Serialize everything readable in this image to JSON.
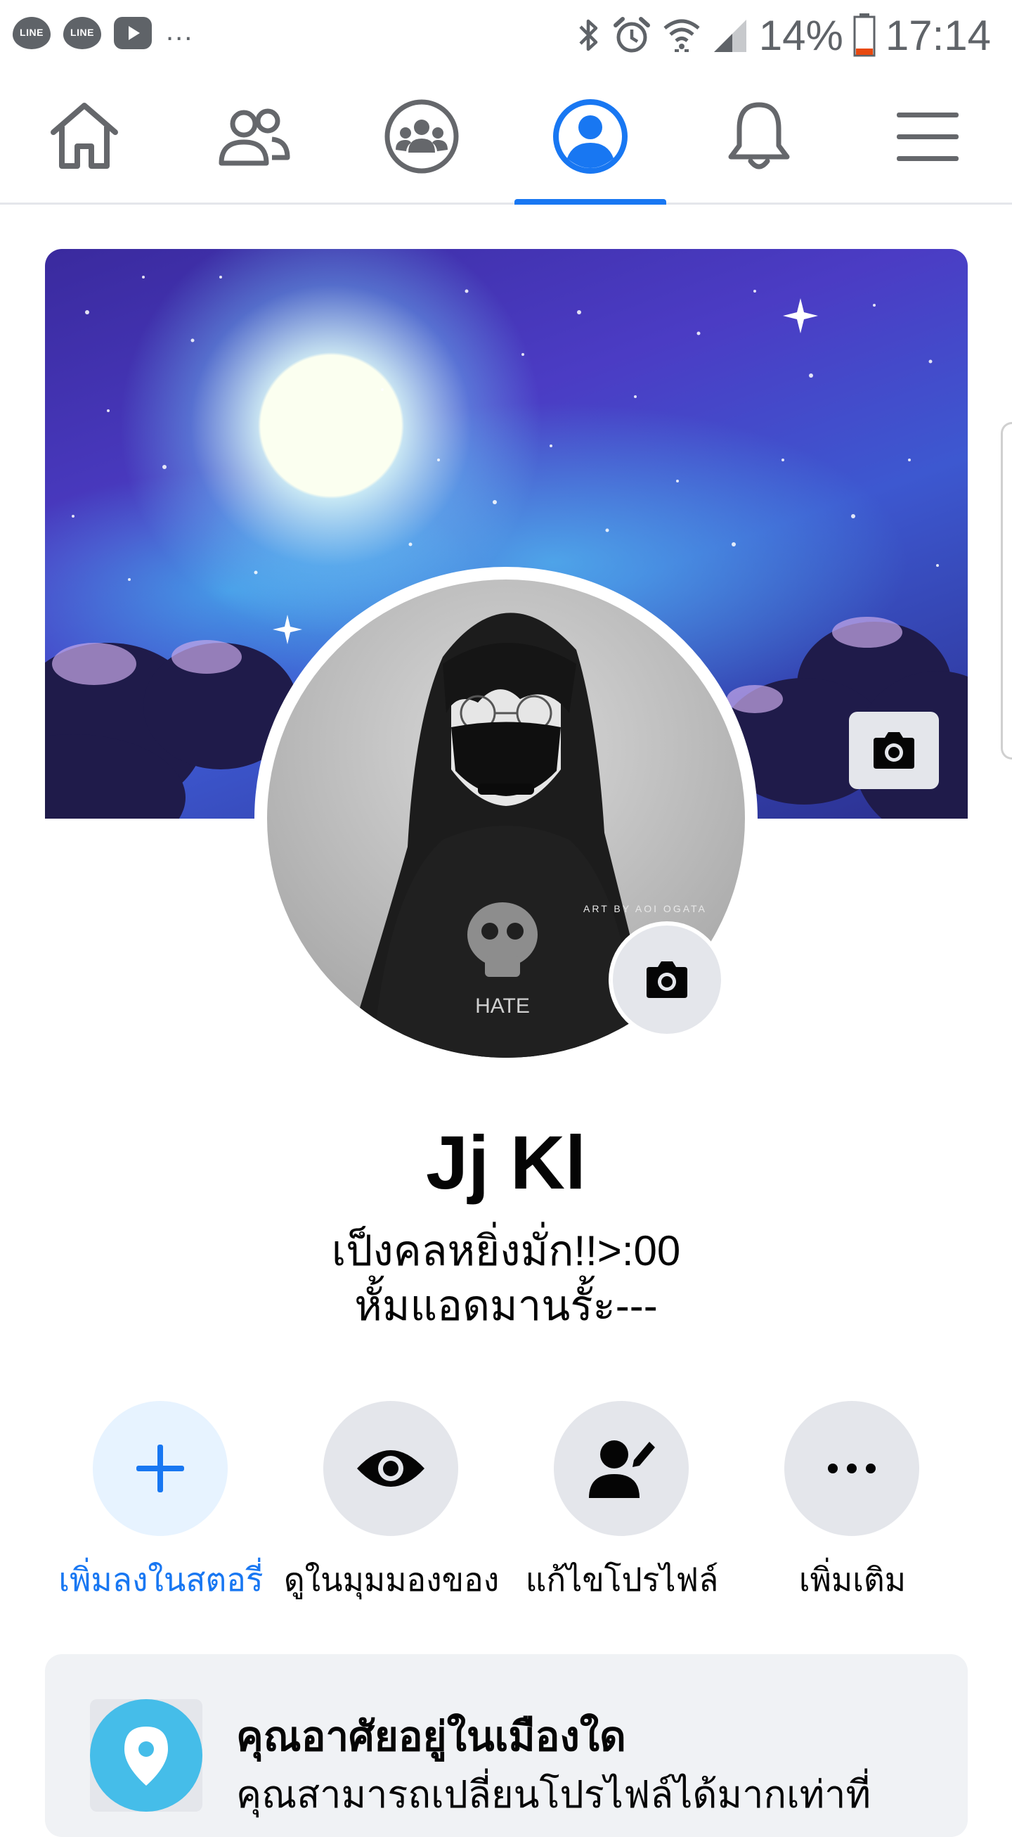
{
  "status_bar": {
    "notifications": [
      {
        "icon": "line-icon",
        "label": "LINE"
      },
      {
        "icon": "line-icon",
        "label": "LINE"
      },
      {
        "icon": "youtube-icon"
      }
    ],
    "more": "...",
    "system_icons": [
      "bluetooth-icon",
      "alarm-icon",
      "wifi-icon",
      "signal-icon"
    ],
    "battery": "14%",
    "battery_color": "#e8490f",
    "time": "17:14"
  },
  "nav": {
    "tabs": [
      {
        "icon": "home-icon",
        "active": false
      },
      {
        "icon": "friends-icon",
        "active": false
      },
      {
        "icon": "groups-icon",
        "active": false
      },
      {
        "icon": "profile-icon",
        "active": true
      },
      {
        "icon": "bell-icon",
        "active": false
      },
      {
        "icon": "menu-icon",
        "active": false
      }
    ],
    "active_color": "#1877f2"
  },
  "profile": {
    "name": "Jj Kl",
    "bio_line1": "เป็งคลหยิ่งมั่ก!!>:00",
    "bio_line2": "หั้มแอดมานรั้ะ---",
    "avatar_caption": "ART BY AOI OGATA",
    "avatar_shirt": "HATE"
  },
  "actions": [
    {
      "label": "เพิ่มลงในสตอรี่",
      "icon": "plus-icon"
    },
    {
      "label": "ดูในมุมมองของ",
      "icon": "eye-icon"
    },
    {
      "label": "แก้ไขโปรไฟล์",
      "icon": "edit-profile-icon"
    },
    {
      "label": "เพิ่มเติม",
      "icon": "more-icon"
    }
  ],
  "city_card": {
    "title": "คุณอาศัยอยู่ในเมืองใด",
    "description": "คุณสามารถเปลี่ยนโปรไฟล์ได้มากเท่าที่"
  }
}
